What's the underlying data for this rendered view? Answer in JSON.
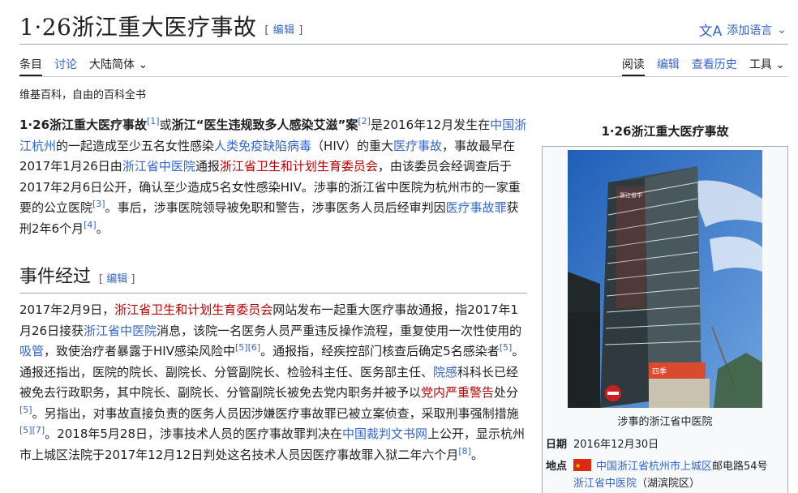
{
  "header": {
    "title": "1·26浙江重大医疗事故",
    "edit_label": "编辑",
    "add_language": "添加语言"
  },
  "tabs_left": [
    {
      "label": "条目"
    },
    {
      "label": "讨论"
    },
    {
      "label": "大陆简体"
    }
  ],
  "tabs_right": [
    {
      "label": "阅读"
    },
    {
      "label": "编辑"
    },
    {
      "label": "查看历史"
    },
    {
      "label": "工具"
    }
  ],
  "tagline": "维基百科，自由的百科全书",
  "lead": {
    "t1": "1·26浙江重大医疗事故",
    "r1": "[1]",
    "t2": "或",
    "t3": "浙江“医生违规致多人感染艾滋”案",
    "r2": "[2]",
    "t4": "是2016年12月发生在",
    "l1": "中国浙江杭州",
    "t5": "的一起造成至少五名女性感染",
    "l2": "人类免疫缺陷病毒",
    "t6": "（HIV）的重大",
    "l3": "医疗事故",
    "t7": "，事故最早在2017年1月26日由",
    "l4": "浙江省中医院",
    "t8": "通报",
    "l5": "浙江省卫生和计划生育委员会",
    "t9": "，由该委员会经调查后于2017年2月6日公开，确认至少造成5名女性感染HIV。涉事的浙江省中医院为杭州市的一家重要的公立医院",
    "r3": "[3]",
    "t10": "。事后，涉事医院领导被免职和警告，涉事医务人员后经审判因",
    "l6": "医疗事故罪",
    "t11": "获刑2年6个月",
    "r4": "[4]",
    "t12": "。"
  },
  "section": {
    "heading": "事件经过",
    "edit_label": "编辑",
    "s1": "2017年2月9日，",
    "l1": "浙江省卫生和计划生育委员会",
    "s2": "网站发布一起重大医疗事故通报，指2017年1月26日接获",
    "l2": "浙江省中医院",
    "s3": "消息，该院一名医务人员严重违反操作流程，重复使用一次性使用的",
    "l3": "吸管",
    "s4": "，致使治疗者暴露于HIV感染风险中",
    "r5": "[5]",
    "r6": "[6]",
    "s5": "。通报指，经疾控部门核查后确定5名感染者",
    "r7": "[5]",
    "s6": "。通报还指出，医院的院长、副院长、分管副院长、检验科主任、医务部主任、",
    "l4": "院感",
    "s7": "科科长已经被免去行政职务，其中院长、副院长、分管副院长被免去党内职务并被予以",
    "l5": "党内严重警告",
    "s8": "处分",
    "r8": "[5]",
    "s9": "。另指出，对事故直接负责的医务人员因涉嫌医疗事故罪已被立案侦查，采取刑事强制措施",
    "r9": "[5]",
    "r10": "[7]",
    "s10": "。2018年5月28日，涉事技术人员的医疗事故罪判决在",
    "l6": "中国裁判文书网",
    "s11": "上公开，显示杭州市上城区法院于2017年12月12日判处这名技术人员因医疗事故罪入狱二年六个月",
    "r11": "[8]",
    "s12": "。"
  },
  "infobox": {
    "title": "1·26浙江重大医疗事故",
    "photo_signs": {
      "sign1": "浙江省中",
      "sign2": "四季"
    },
    "caption": "涉事的浙江省中医院",
    "date_label": "日期",
    "date_value": "2016年12月30日",
    "place_label": "地点",
    "place_link": "中国浙江省杭州市上城区",
    "place_text": "邮电路54号",
    "place_link2": "浙江省中医院",
    "place_text2": "（湖滨院区）"
  },
  "colors": {
    "link": "#3366cc",
    "redlink": "#ba0000",
    "text": "#202122"
  }
}
